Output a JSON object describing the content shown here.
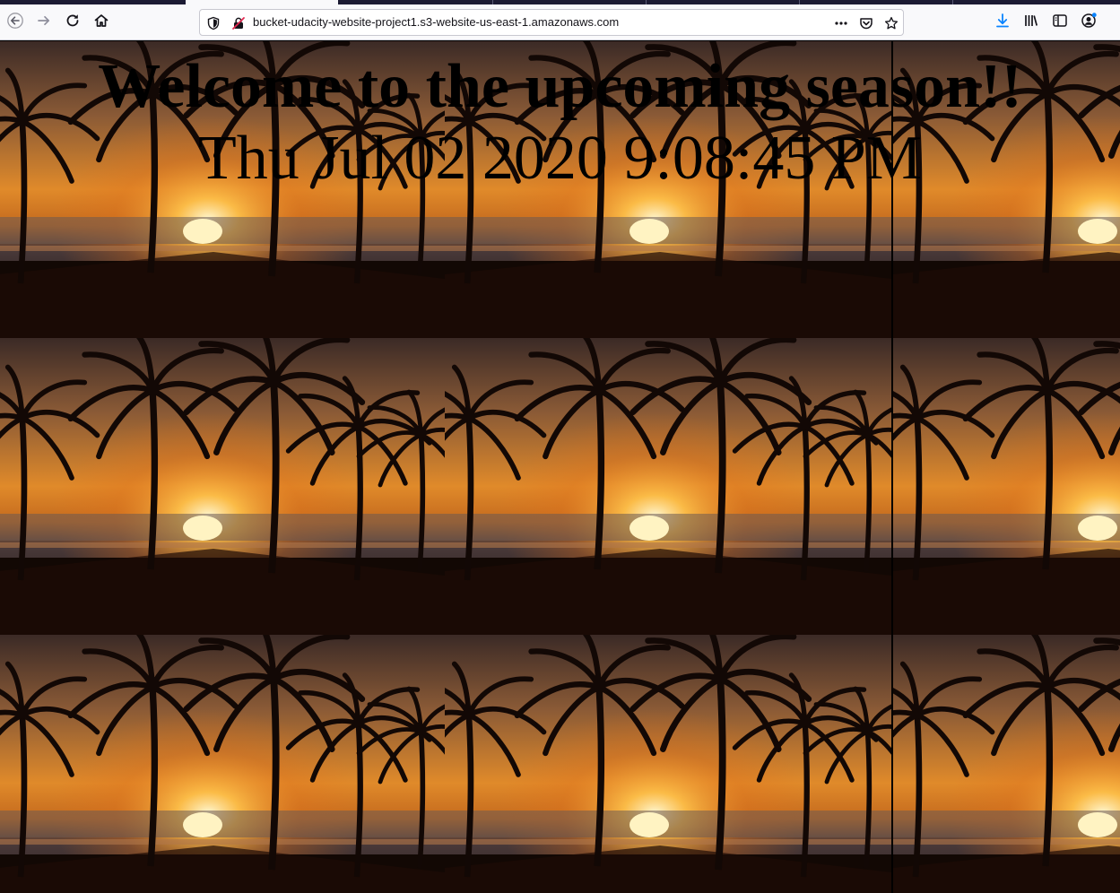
{
  "browser": {
    "url": "bucket-udacity-website-project1.s3-website-us-east-1.amazonaws.com",
    "icons": [
      "back-icon",
      "forward-icon",
      "reload-icon",
      "home-icon",
      "shield-icon",
      "insecure-lock-icon",
      "more-icon",
      "pocket-icon",
      "bookmark-star-icon",
      "download-icon",
      "library-icon",
      "sidebar-icon",
      "account-icon"
    ],
    "accent_color": "#0a84ff"
  },
  "page": {
    "heading": "Welcome to the upcoming season!!",
    "datetime": "Thu Jul 02 2020 9:08:45 PM",
    "background": "tiled-sunset-palm-image"
  }
}
